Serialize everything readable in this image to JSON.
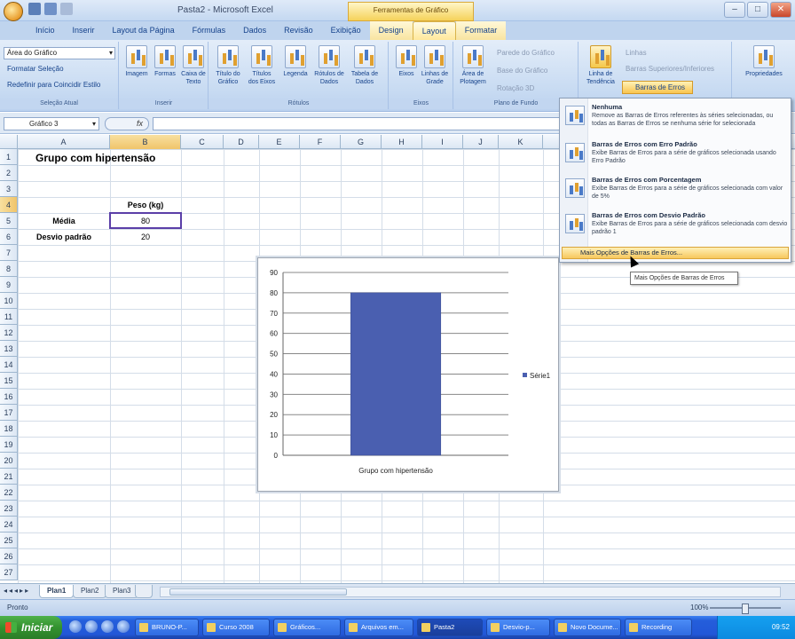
{
  "window": {
    "title": "Pasta2 - Microsoft Excel",
    "context_tab_group": "Ferramentas de Gráfico"
  },
  "tabs": [
    "Início",
    "Inserir",
    "Layout da Página",
    "Fórmulas",
    "Dados",
    "Revisão",
    "Exibição",
    "Design",
    "Layout",
    "Formatar"
  ],
  "ribbon": {
    "selection": {
      "dropdown_value": "Área do Gráfico",
      "format_selection": "Formatar Seleção",
      "reset_style": "Redefinir para Coincidir Estilo",
      "label": "Seleção Atual"
    },
    "insert": {
      "image": "Imagem",
      "shapes": "Formas",
      "textbox": "Caixa de Texto",
      "label": "Inserir"
    },
    "labels": {
      "chart_title": "Título do Gráfico",
      "axis_titles": "Títulos dos Eixos",
      "legend": "Legenda",
      "data_labels": "Rótulos de Dados",
      "data_table": "Tabela de Dados",
      "label": "Rótulos"
    },
    "axes": {
      "axes": "Eixos",
      "gridlines": "Linhas de Grade",
      "label": "Eixos"
    },
    "background": {
      "plot_area": "Área de Plotagem",
      "chart_wall": "Parede do Gráfico",
      "chart_floor": "Base do Gráfico",
      "rotation": "Rotação 3D",
      "label": "Plano de Fundo"
    },
    "analysis": {
      "trendline": "Linha de Tendência",
      "lines": "Linhas",
      "updown_bars": "Barras Superiores/Inferiores",
      "error_bars": "Barras de Erros"
    },
    "properties": {
      "label": "Propriedades"
    }
  },
  "formula_bar": {
    "name_box": "Gráfico 3",
    "fx": "fx"
  },
  "columns": [
    "A",
    "B",
    "C",
    "D",
    "E",
    "F",
    "G",
    "H",
    "I",
    "J",
    "K"
  ],
  "rows": [
    "1",
    "2",
    "3",
    "4",
    "5",
    "6",
    "7",
    "8",
    "9",
    "10",
    "11",
    "12",
    "13",
    "14",
    "15",
    "16",
    "17",
    "18",
    "19",
    "20",
    "21",
    "22",
    "23",
    "24",
    "25",
    "26",
    "27"
  ],
  "cells": {
    "title": "Grupo com hipertensão",
    "peso_header": "Peso (kg)",
    "media_label": "Média",
    "media_value": "80",
    "desvio_label": "Desvio padrão",
    "desvio_value": "20"
  },
  "chart_data": {
    "type": "bar",
    "categories": [
      "Grupo com hipertensão"
    ],
    "series": [
      {
        "name": "Série1",
        "values": [
          80
        ],
        "color": "#4a5fb0"
      }
    ],
    "yticks": [
      "0",
      "10",
      "20",
      "30",
      "40",
      "50",
      "60",
      "70",
      "80",
      "90"
    ],
    "ylim": [
      0,
      90
    ],
    "grid": true,
    "legend": "right"
  },
  "dropdown": {
    "items": [
      {
        "title": "Nenhuma",
        "desc": "Remove as Barras de Erros referentes às séries selecionadas, ou todas as Barras de Erros se nenhuma série for selecionada"
      },
      {
        "title": "Barras de Erros com Erro Padrão",
        "desc": "Exibe Barras de Erros para a série de gráficos selecionada usando Erro Padrão"
      },
      {
        "title": "Barras de Erros com Porcentagem",
        "desc": "Exibe Barras de Erros para a série de gráficos selecionada com valor de 5%"
      },
      {
        "title": "Barras de Erros com Desvio Padrão",
        "desc": "Exibe Barras de Erros para a série de gráficos selecionada com desvio padrão 1"
      }
    ],
    "more": "Mais Opções de Barras de Erros..."
  },
  "tooltip": "Mais Opções de Barras de Erros",
  "sheets": [
    "Plan1",
    "Plan2",
    "Plan3"
  ],
  "status": {
    "mode": "Pronto",
    "zoom": "100%"
  },
  "taskbar": {
    "start": "Iniciar",
    "items": [
      "BRUNO-P...",
      "Curso 2008",
      "Gráficos...",
      "Arquivos em...",
      "Pasta2",
      "Desvio-p...",
      "Novo Docume...",
      "Recording"
    ],
    "clock": "09:52"
  }
}
